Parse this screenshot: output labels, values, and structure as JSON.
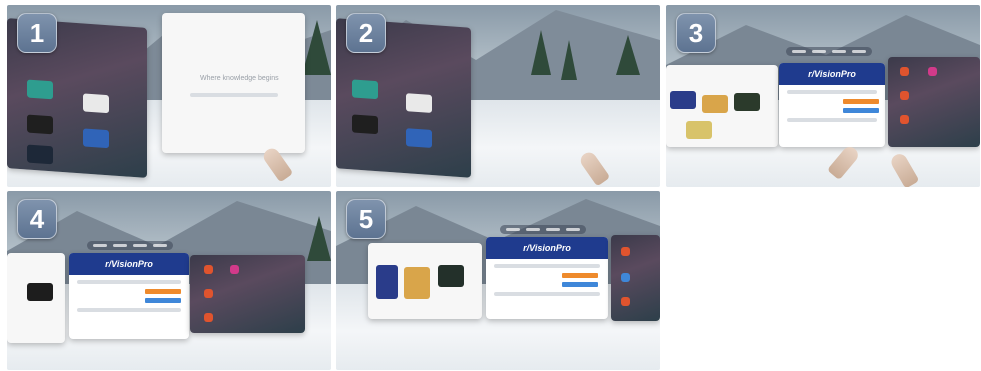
{
  "panels": [
    {
      "number": "1",
      "tagline": "Where knowledge begins"
    },
    {
      "number": "2"
    },
    {
      "number": "3",
      "header_text": "r/VisionPro"
    },
    {
      "number": "4",
      "header_text": "r/VisionPro"
    },
    {
      "number": "5",
      "header_text": "r/VisionPro"
    }
  ],
  "colors": {
    "badge": "#6a809d",
    "reddit_header": "#1f3b8e",
    "reddit_orange": "#ee8a2c",
    "reddit_blue": "#3f87d9",
    "snow": "#eef1f4"
  }
}
